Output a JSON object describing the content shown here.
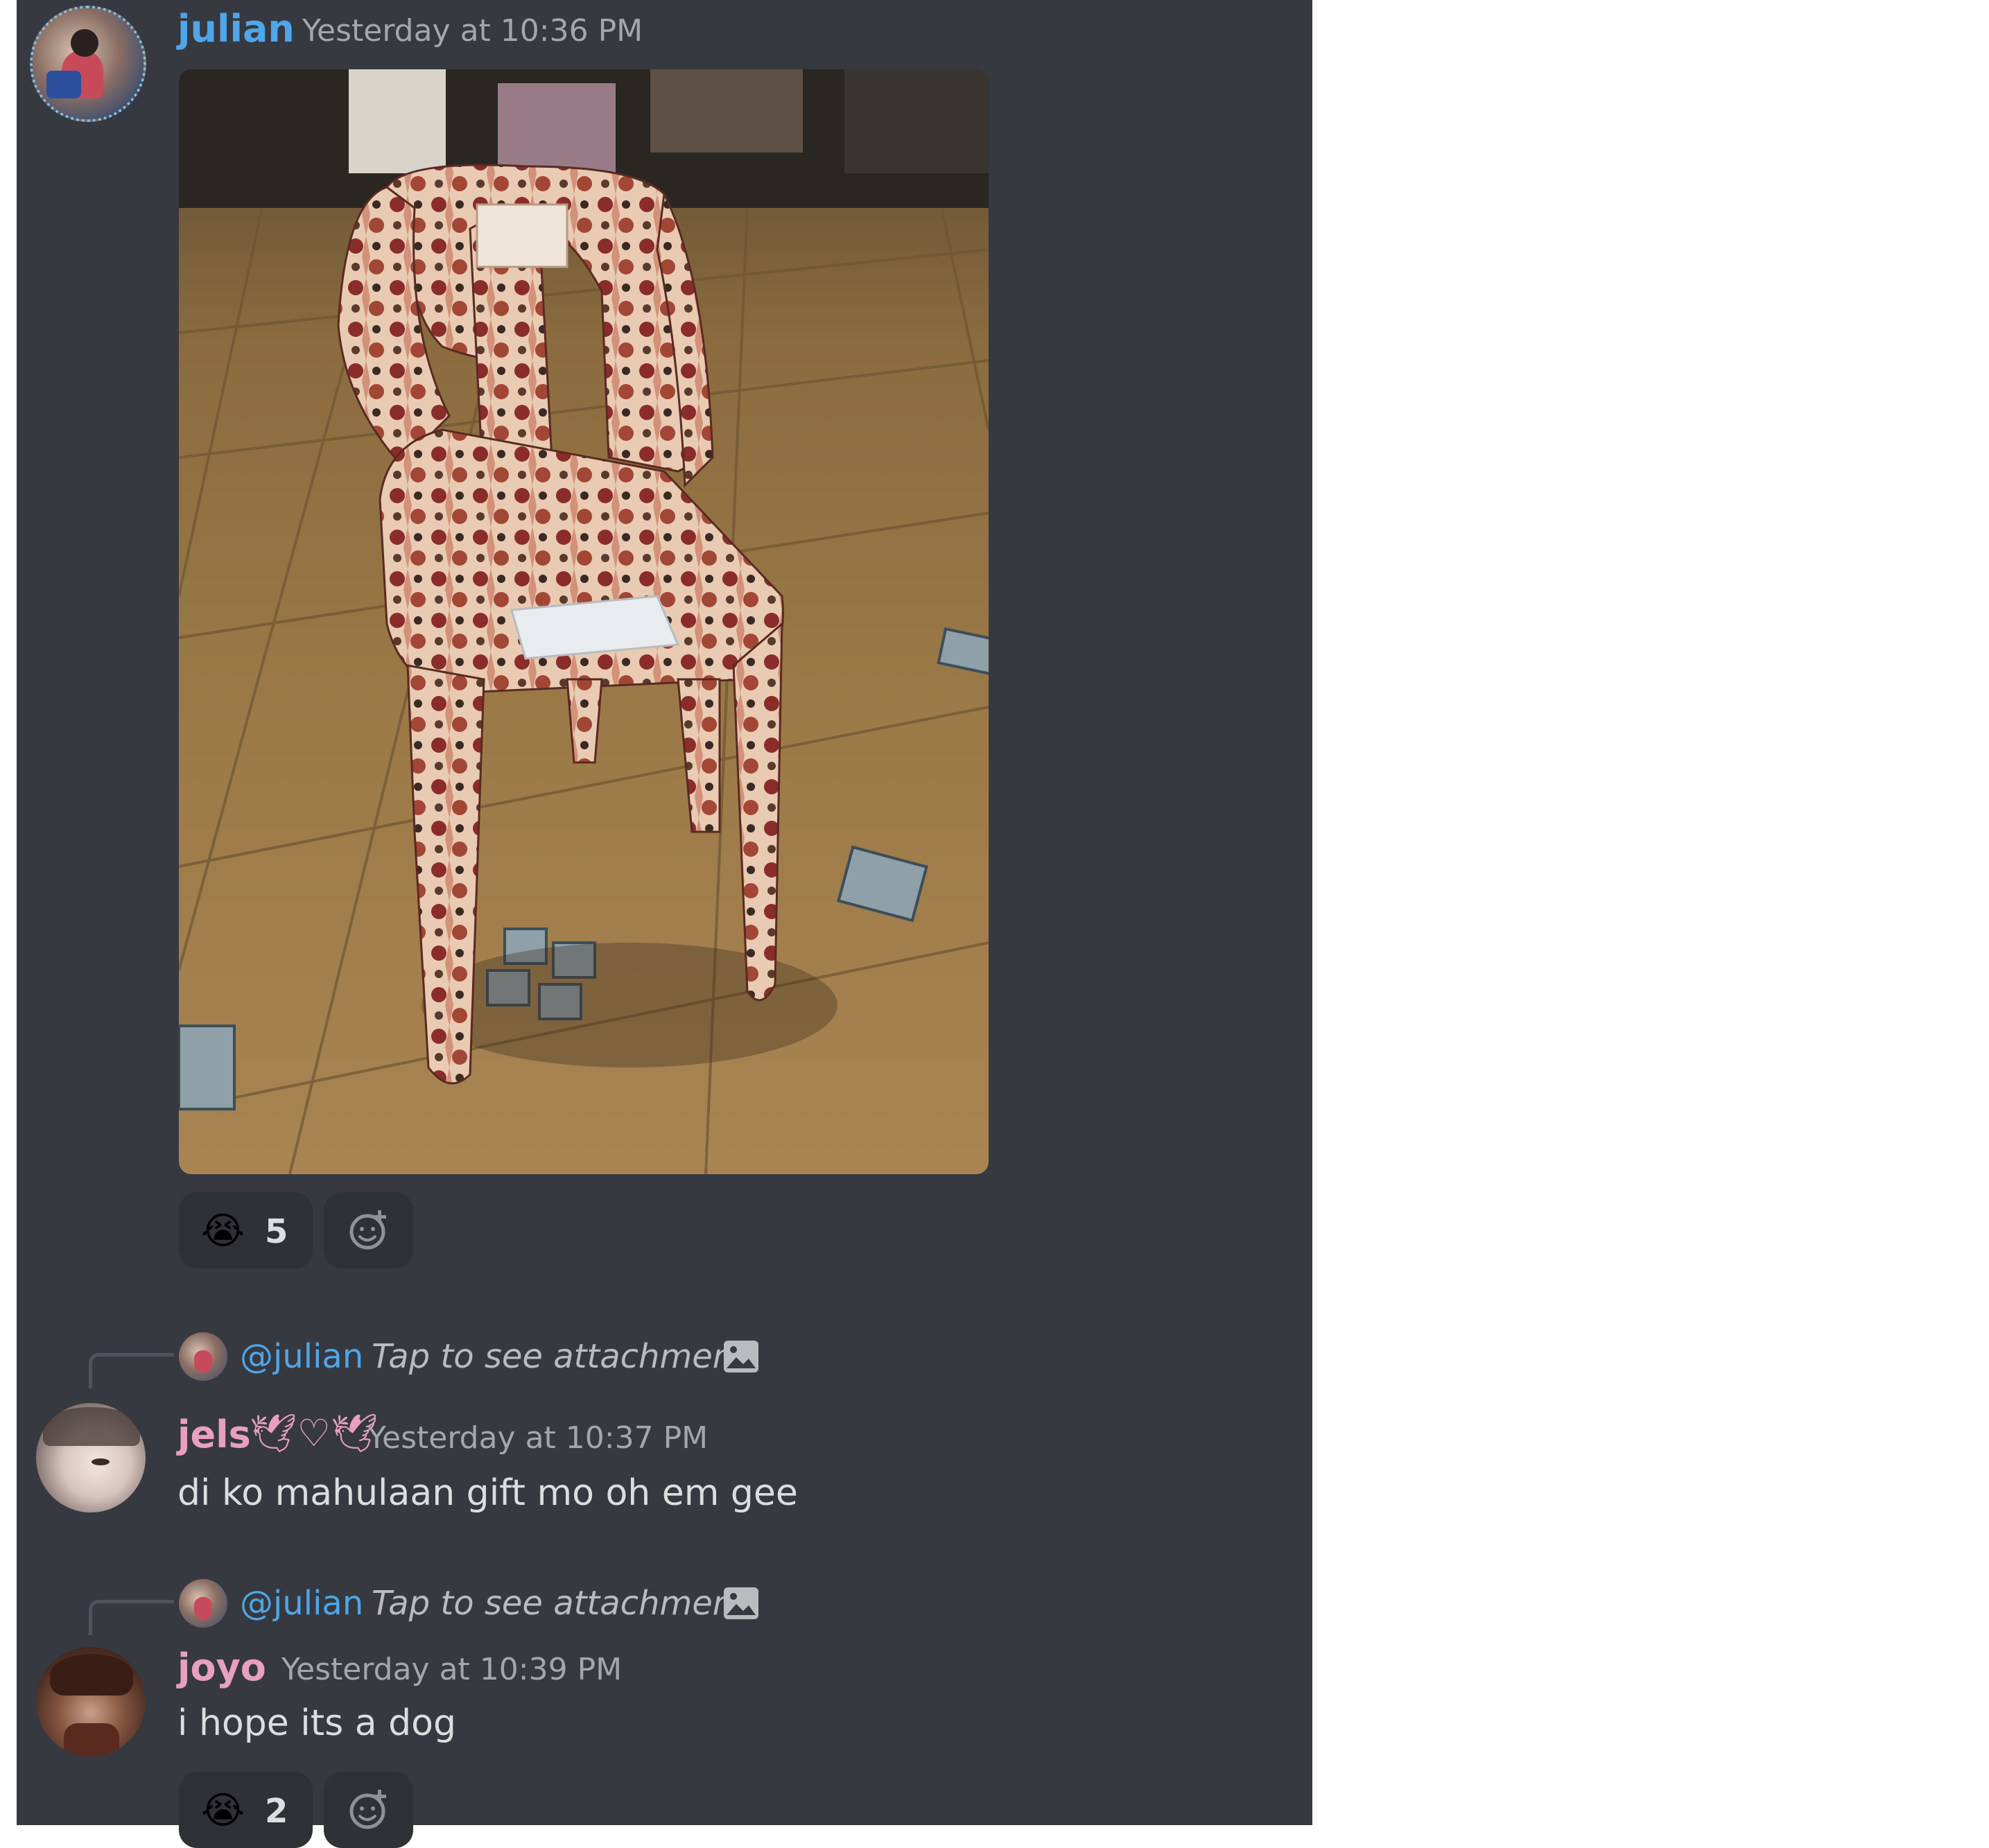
{
  "messages": [
    {
      "author": "julian",
      "timestamp": "Yesterday at 10:36 PM",
      "attachment": "image",
      "reactions": [
        {
          "emoji": "😭",
          "count": "5"
        }
      ]
    },
    {
      "reply": {
        "mention": "@julian",
        "text": "Tap to see attachment"
      },
      "author": "jels",
      "author_deco": "🕊♡🕊",
      "timestamp": "Yesterday at 10:37 PM",
      "text": "di ko mahulaan gift mo oh em gee"
    },
    {
      "reply": {
        "mention": "@julian",
        "text": "Tap to see attachment"
      },
      "author": "joyo",
      "timestamp": "Yesterday at 10:39 PM",
      "text": "i hope its a dog",
      "reactions": [
        {
          "emoji": "😭",
          "count": "2"
        }
      ]
    }
  ],
  "colors": {
    "background": "#36393f",
    "julian": "#4fa6e8",
    "jels": "#e8a0c0",
    "joyo": "#e8a0c0",
    "reaction_bg": "#2f3136"
  },
  "icons": {
    "add_reaction": "add-reaction-icon",
    "image_attachment": "image-icon"
  }
}
